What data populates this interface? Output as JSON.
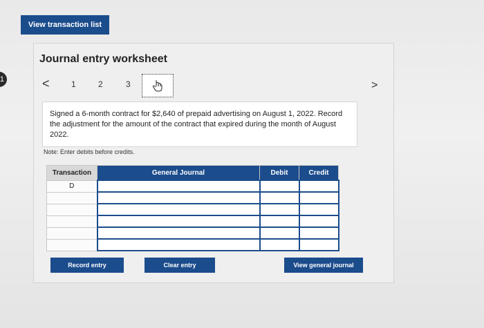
{
  "page_marker": "1",
  "top_button": "View transaction list",
  "worksheet": {
    "title": "Journal entry worksheet",
    "nav": {
      "prev": "<",
      "steps": [
        "1",
        "2",
        "3"
      ],
      "next": ">"
    },
    "description": "Signed a 6-month contract for $2,640 of prepaid advertising on August 1, 2022. Record the adjustment for the amount of the contract that expired during the month of August 2022.",
    "note": "Note: Enter debits before credits.",
    "table": {
      "headers": [
        "Transaction",
        "General Journal",
        "Debit",
        "Credit"
      ],
      "rows": [
        [
          "D",
          "",
          "",
          ""
        ],
        [
          "",
          "",
          "",
          ""
        ],
        [
          "",
          "",
          "",
          ""
        ],
        [
          "",
          "",
          "",
          ""
        ],
        [
          "",
          "",
          "",
          ""
        ],
        [
          "",
          "",
          "",
          ""
        ]
      ]
    },
    "buttons": {
      "record": "Record entry",
      "clear": "Clear entry",
      "view_journal": "View general journal"
    }
  }
}
